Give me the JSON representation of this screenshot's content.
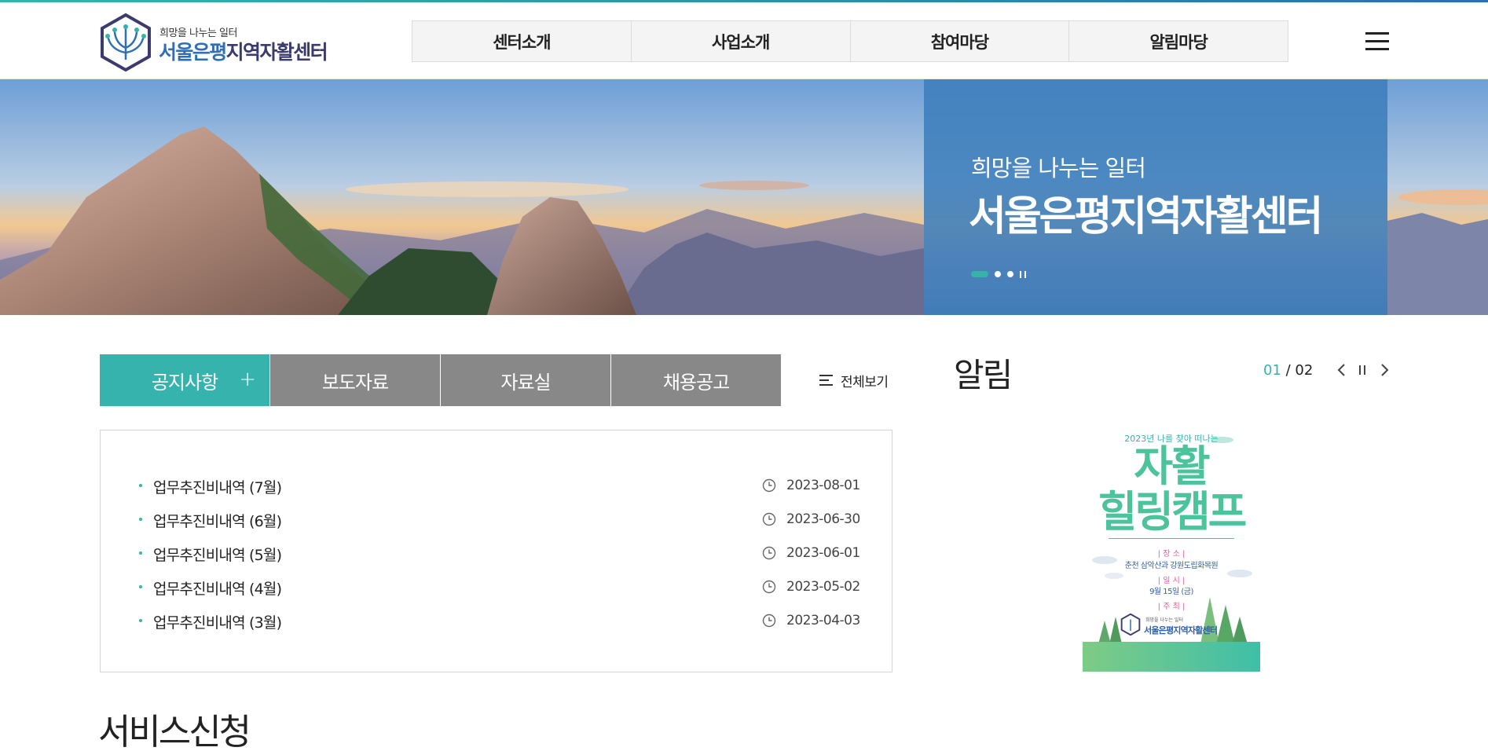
{
  "header": {
    "logo": {
      "subtitle": "희망을 나누는 일터",
      "title_part1": "서울은평",
      "title_part2": "지역자활센터"
    },
    "gnb": [
      "센터소개",
      "사업소개",
      "참여마당",
      "알림마당"
    ],
    "menu_icon": "hamburger-icon"
  },
  "visual": {
    "subtitle": "희망을 나누는 일터",
    "title": "서울은평지역자활센터",
    "slides_count": 3,
    "active_slide": 1
  },
  "board": {
    "tabs": [
      "공지사항",
      "보도자료",
      "자료실",
      "채용공고"
    ],
    "active_tab": 0,
    "tab_plus": "+",
    "view_all": "전체보기",
    "items": [
      {
        "title": "업무추진비내역 (7월)",
        "date": "2023-08-01"
      },
      {
        "title": "업무추진비내역 (6월)",
        "date": "2023-06-30"
      },
      {
        "title": "업무추진비내역 (5월)",
        "date": "2023-06-01"
      },
      {
        "title": "업무추진비내역 (4월)",
        "date": "2023-05-02"
      },
      {
        "title": "업무추진비내역 (3월)",
        "date": "2023-04-03"
      }
    ]
  },
  "alarm": {
    "title": "알림",
    "pager_current": "01",
    "pager_sep": " / ",
    "pager_total": "02",
    "poster": {
      "top": "2023년 나를 찾아 떠나는",
      "big1": "자활",
      "big2": "힐링캠프",
      "label_place": "| 장 소 |",
      "place": "춘천 삼악산과 강원도립화목원",
      "label_date": "| 일 시 |",
      "date": "9월 15일 (금)",
      "label_host": "| 주 최 |",
      "host_sub": "희망을 나누는 일터",
      "host": "서울은평지역자활센터"
    }
  },
  "service": {
    "title": "서비스신청"
  },
  "colors": {
    "accent": "#36b3ad",
    "tab_gray": "#888888",
    "banner_box": "#3e7ebc",
    "logo_blue": "#2f6fb6"
  }
}
